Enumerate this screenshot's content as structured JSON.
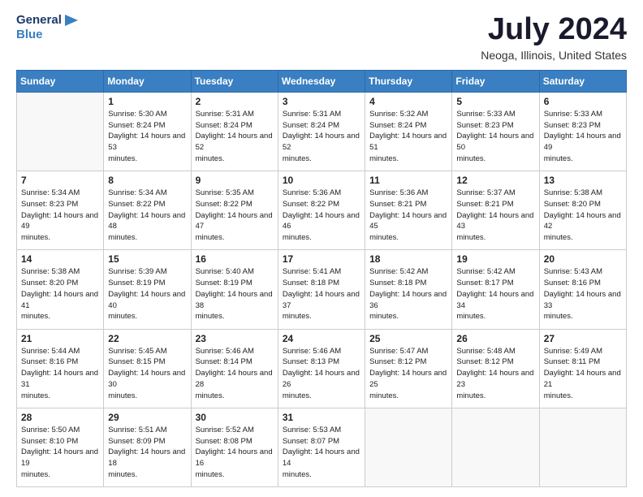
{
  "header": {
    "logo_line1": "General",
    "logo_line2": "Blue",
    "title": "July 2024",
    "location": "Neoga, Illinois, United States"
  },
  "days_of_week": [
    "Sunday",
    "Monday",
    "Tuesday",
    "Wednesday",
    "Thursday",
    "Friday",
    "Saturday"
  ],
  "weeks": [
    [
      {
        "day": "",
        "empty": true
      },
      {
        "day": "1",
        "sunrise": "5:30 AM",
        "sunset": "8:24 PM",
        "daylight": "14 hours and 53 minutes."
      },
      {
        "day": "2",
        "sunrise": "5:31 AM",
        "sunset": "8:24 PM",
        "daylight": "14 hours and 52 minutes."
      },
      {
        "day": "3",
        "sunrise": "5:31 AM",
        "sunset": "8:24 PM",
        "daylight": "14 hours and 52 minutes."
      },
      {
        "day": "4",
        "sunrise": "5:32 AM",
        "sunset": "8:24 PM",
        "daylight": "14 hours and 51 minutes."
      },
      {
        "day": "5",
        "sunrise": "5:33 AM",
        "sunset": "8:23 PM",
        "daylight": "14 hours and 50 minutes."
      },
      {
        "day": "6",
        "sunrise": "5:33 AM",
        "sunset": "8:23 PM",
        "daylight": "14 hours and 49 minutes."
      }
    ],
    [
      {
        "day": "7",
        "sunrise": "5:34 AM",
        "sunset": "8:23 PM",
        "daylight": "14 hours and 49 minutes."
      },
      {
        "day": "8",
        "sunrise": "5:34 AM",
        "sunset": "8:22 PM",
        "daylight": "14 hours and 48 minutes."
      },
      {
        "day": "9",
        "sunrise": "5:35 AM",
        "sunset": "8:22 PM",
        "daylight": "14 hours and 47 minutes."
      },
      {
        "day": "10",
        "sunrise": "5:36 AM",
        "sunset": "8:22 PM",
        "daylight": "14 hours and 46 minutes."
      },
      {
        "day": "11",
        "sunrise": "5:36 AM",
        "sunset": "8:21 PM",
        "daylight": "14 hours and 45 minutes."
      },
      {
        "day": "12",
        "sunrise": "5:37 AM",
        "sunset": "8:21 PM",
        "daylight": "14 hours and 43 minutes."
      },
      {
        "day": "13",
        "sunrise": "5:38 AM",
        "sunset": "8:20 PM",
        "daylight": "14 hours and 42 minutes."
      }
    ],
    [
      {
        "day": "14",
        "sunrise": "5:38 AM",
        "sunset": "8:20 PM",
        "daylight": "14 hours and 41 minutes."
      },
      {
        "day": "15",
        "sunrise": "5:39 AM",
        "sunset": "8:19 PM",
        "daylight": "14 hours and 40 minutes."
      },
      {
        "day": "16",
        "sunrise": "5:40 AM",
        "sunset": "8:19 PM",
        "daylight": "14 hours and 38 minutes."
      },
      {
        "day": "17",
        "sunrise": "5:41 AM",
        "sunset": "8:18 PM",
        "daylight": "14 hours and 37 minutes."
      },
      {
        "day": "18",
        "sunrise": "5:42 AM",
        "sunset": "8:18 PM",
        "daylight": "14 hours and 36 minutes."
      },
      {
        "day": "19",
        "sunrise": "5:42 AM",
        "sunset": "8:17 PM",
        "daylight": "14 hours and 34 minutes."
      },
      {
        "day": "20",
        "sunrise": "5:43 AM",
        "sunset": "8:16 PM",
        "daylight": "14 hours and 33 minutes."
      }
    ],
    [
      {
        "day": "21",
        "sunrise": "5:44 AM",
        "sunset": "8:16 PM",
        "daylight": "14 hours and 31 minutes."
      },
      {
        "day": "22",
        "sunrise": "5:45 AM",
        "sunset": "8:15 PM",
        "daylight": "14 hours and 30 minutes."
      },
      {
        "day": "23",
        "sunrise": "5:46 AM",
        "sunset": "8:14 PM",
        "daylight": "14 hours and 28 minutes."
      },
      {
        "day": "24",
        "sunrise": "5:46 AM",
        "sunset": "8:13 PM",
        "daylight": "14 hours and 26 minutes."
      },
      {
        "day": "25",
        "sunrise": "5:47 AM",
        "sunset": "8:12 PM",
        "daylight": "14 hours and 25 minutes."
      },
      {
        "day": "26",
        "sunrise": "5:48 AM",
        "sunset": "8:12 PM",
        "daylight": "14 hours and 23 minutes."
      },
      {
        "day": "27",
        "sunrise": "5:49 AM",
        "sunset": "8:11 PM",
        "daylight": "14 hours and 21 minutes."
      }
    ],
    [
      {
        "day": "28",
        "sunrise": "5:50 AM",
        "sunset": "8:10 PM",
        "daylight": "14 hours and 19 minutes."
      },
      {
        "day": "29",
        "sunrise": "5:51 AM",
        "sunset": "8:09 PM",
        "daylight": "14 hours and 18 minutes."
      },
      {
        "day": "30",
        "sunrise": "5:52 AM",
        "sunset": "8:08 PM",
        "daylight": "14 hours and 16 minutes."
      },
      {
        "day": "31",
        "sunrise": "5:53 AM",
        "sunset": "8:07 PM",
        "daylight": "14 hours and 14 minutes."
      },
      {
        "day": "",
        "empty": true
      },
      {
        "day": "",
        "empty": true
      },
      {
        "day": "",
        "empty": true
      }
    ]
  ]
}
